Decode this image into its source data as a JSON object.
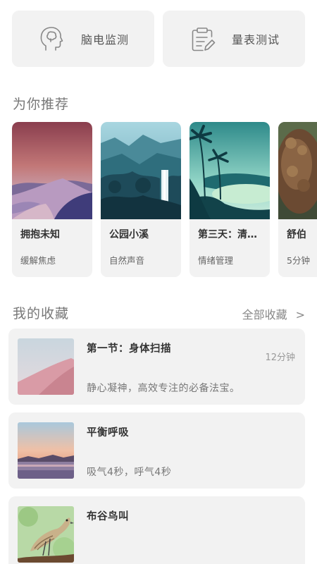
{
  "top_cards": [
    {
      "label": "脑电监测",
      "icon": "head-brain-icon"
    },
    {
      "label": "量表测试",
      "icon": "clipboard-edit-icon"
    }
  ],
  "recommend": {
    "title": "为你推荐",
    "items": [
      {
        "title": "拥抱未知",
        "subtitle": "缓解焦虑",
        "image": "desert-dunes-dusk"
      },
      {
        "title": "公园小溪",
        "subtitle": "自然声音",
        "image": "forest-waterfall"
      },
      {
        "title": "第三天：清理...",
        "subtitle": "情绪管理",
        "image": "tropical-lake-palms"
      },
      {
        "title": "舒伯",
        "subtitle": "5分钟",
        "image": "woman-curly-hair"
      }
    ]
  },
  "favorites": {
    "title": "我的收藏",
    "all_label": "全部收藏",
    "chevron": ">",
    "items": [
      {
        "title": "第一节：身体扫描",
        "desc": "静心凝神，高效专注的必备法宝。",
        "duration": "12分钟",
        "image": "pink-dune"
      },
      {
        "title": "平衡呼吸",
        "desc": "吸气4秒，呼气4秒",
        "duration": "",
        "image": "sunset-lake"
      },
      {
        "title": "布谷鸟叫",
        "desc": "",
        "duration": "",
        "image": "cuckoo-bird"
      }
    ]
  }
}
